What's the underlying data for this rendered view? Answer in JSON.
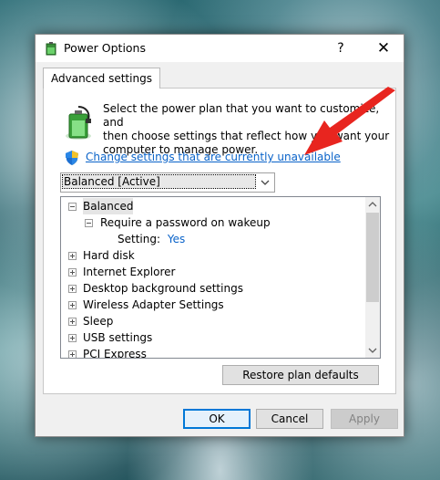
{
  "window": {
    "title": "Power Options",
    "help_label": "?",
    "close_label": "✕"
  },
  "tab": {
    "label": "Advanced settings"
  },
  "description": "Select the power plan that you want to customize, and\nthen choose settings that reflect how you want your\ncomputer to manage power.",
  "change_link": "Change settings that are currently unavailable",
  "plan_select": {
    "value": "Balanced [Active]"
  },
  "tree": {
    "root": "Balanced",
    "child": "Require a password on wakeup",
    "setting_label": "Setting:",
    "setting_value": "Yes",
    "items": [
      "Hard disk",
      "Internet Explorer",
      "Desktop background settings",
      "Wireless Adapter Settings",
      "Sleep",
      "USB settings",
      "PCI Express"
    ]
  },
  "buttons": {
    "restore": "Restore plan defaults",
    "ok": "OK",
    "cancel": "Cancel",
    "apply": "Apply"
  },
  "colors": {
    "link": "#0a63c9",
    "setting_value": "#0a63c9",
    "arrow": "#e8251f",
    "ok_border": "#0078d7"
  },
  "icons": [
    "power-plan-icon",
    "shield-icon",
    "expand-icon",
    "collapse-icon",
    "chevron-down-icon",
    "arrow-pointer-icon"
  ]
}
